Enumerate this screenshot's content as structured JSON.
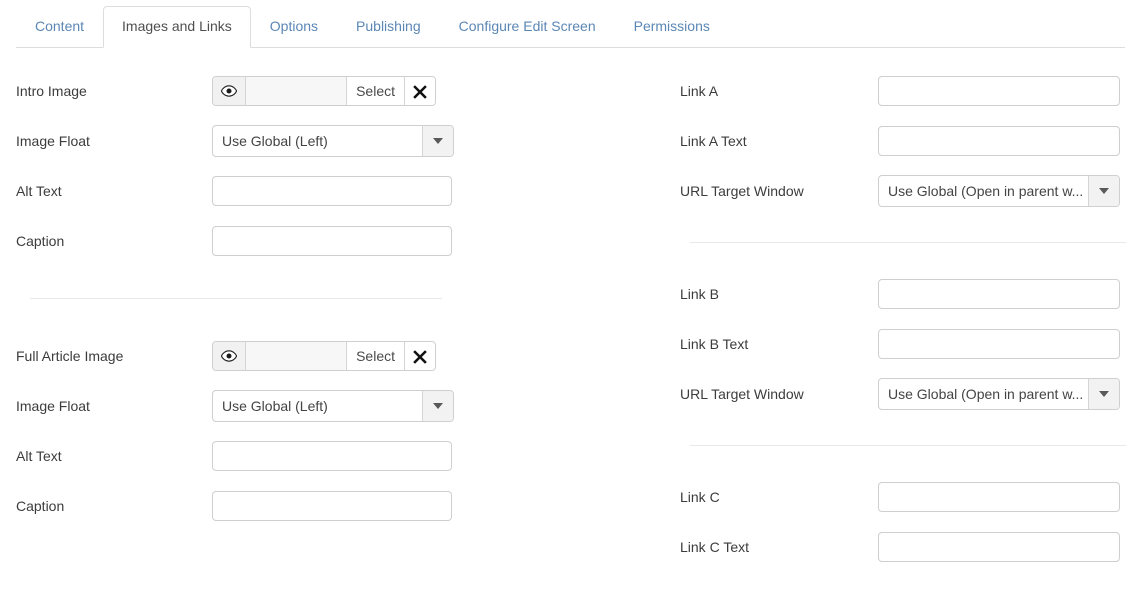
{
  "tabs": [
    {
      "label": "Content",
      "active": false
    },
    {
      "label": "Images and Links",
      "active": true
    },
    {
      "label": "Options",
      "active": false
    },
    {
      "label": "Publishing",
      "active": false
    },
    {
      "label": "Configure Edit Screen",
      "active": false
    },
    {
      "label": "Permissions",
      "active": false
    }
  ],
  "colors": {
    "tab_link": "#5b87b5",
    "tab_active_text": "#4f4f4f",
    "border": "#dddddd",
    "input_border": "#cfcfcf",
    "separator": "#e8e8e8"
  },
  "media_buttons": {
    "select_label": "Select",
    "preview_icon": "eye-icon",
    "clear_icon": "x-icon"
  },
  "left_column": {
    "intro": {
      "image_label": "Intro Image",
      "image_value": "",
      "float_label": "Image Float",
      "float_value": "Use Global (Left)",
      "alt_label": "Alt Text",
      "alt_value": "",
      "caption_label": "Caption",
      "caption_value": ""
    },
    "full": {
      "image_label": "Full Article Image",
      "image_value": "",
      "float_label": "Image Float",
      "float_value": "Use Global (Left)",
      "alt_label": "Alt Text",
      "alt_value": "",
      "caption_label": "Caption",
      "caption_value": ""
    }
  },
  "right_column": {
    "link_a": {
      "url_label": "Link A",
      "url_value": "",
      "text_label": "Link A Text",
      "text_value": "",
      "target_label": "URL Target Window",
      "target_value": "Use Global (Open in parent w..."
    },
    "link_b": {
      "url_label": "Link B",
      "url_value": "",
      "text_label": "Link B Text",
      "text_value": "",
      "target_label": "URL Target Window",
      "target_value": "Use Global (Open in parent w..."
    },
    "link_c": {
      "url_label": "Link C",
      "url_value": "",
      "text_label": "Link C Text",
      "text_value": ""
    }
  }
}
